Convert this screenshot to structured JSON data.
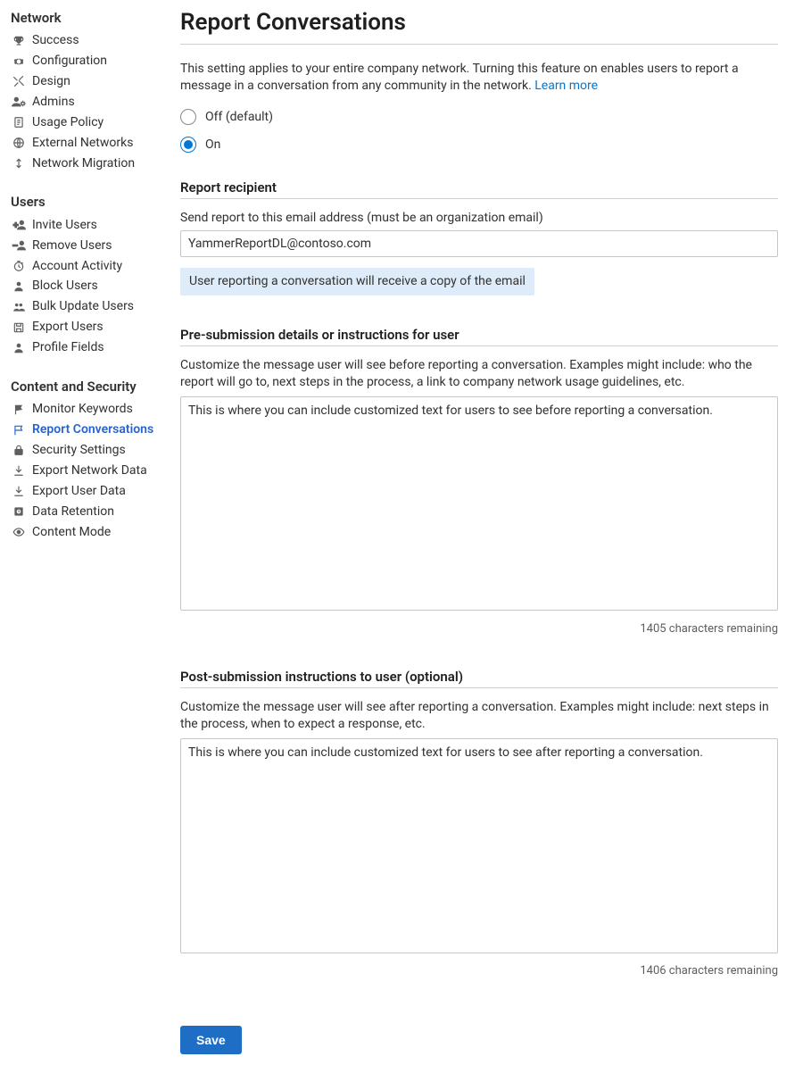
{
  "sidebar": {
    "groups": [
      {
        "title": "Network",
        "items": [
          {
            "label": "Success",
            "selected": false
          },
          {
            "label": "Configuration",
            "selected": false
          },
          {
            "label": "Design",
            "selected": false
          },
          {
            "label": "Admins",
            "selected": false
          },
          {
            "label": "Usage Policy",
            "selected": false
          },
          {
            "label": "External Networks",
            "selected": false
          },
          {
            "label": "Network Migration",
            "selected": false
          }
        ]
      },
      {
        "title": "Users",
        "items": [
          {
            "label": "Invite Users",
            "selected": false
          },
          {
            "label": "Remove Users",
            "selected": false
          },
          {
            "label": "Account Activity",
            "selected": false
          },
          {
            "label": "Block Users",
            "selected": false
          },
          {
            "label": "Bulk Update Users",
            "selected": false
          },
          {
            "label": "Export Users",
            "selected": false
          },
          {
            "label": "Profile Fields",
            "selected": false
          }
        ]
      },
      {
        "title": "Content and Security",
        "items": [
          {
            "label": "Monitor Keywords",
            "selected": false
          },
          {
            "label": "Report Conversations",
            "selected": true
          },
          {
            "label": "Security Settings",
            "selected": false
          },
          {
            "label": "Export Network Data",
            "selected": false
          },
          {
            "label": "Export User Data",
            "selected": false
          },
          {
            "label": "Data Retention",
            "selected": false
          },
          {
            "label": "Content Mode",
            "selected": false
          }
        ]
      }
    ]
  },
  "page": {
    "title": "Report Conversations",
    "description": "This setting applies to your entire company network. Turning this feature on enables users to report a message in a conversation from any community in the network. ",
    "learn_more": "Learn more",
    "radio_off_label": "Off (default)",
    "radio_on_label": "On",
    "radio_selected": "on",
    "recipient": {
      "title": "Report recipient",
      "label": "Send report to this email address (must be an organization email)",
      "value": "YammerReportDL@contoso.com",
      "info": "User reporting a conversation will receive a copy of the email"
    },
    "pre": {
      "title": "Pre-submission details or instructions for user",
      "help": "Customize the message user will see before reporting a conversation. Examples might include: who the report will go to, next steps in the process, a link to company network usage guidelines, etc.",
      "value": "This is where you can include customized text for users to see before reporting a conversation.",
      "remaining": "1405 characters remaining"
    },
    "post": {
      "title": "Post-submission instructions to user (optional)",
      "help": "Customize the message user will see after reporting a conversation. Examples might include: next steps in the process, when to expect a response, etc.",
      "value": "This is where you can include customized text for users to see after reporting a conversation.",
      "remaining": "1406 characters remaining"
    },
    "save_label": "Save"
  },
  "icons": {
    "trophy": "trophy-icon",
    "gear": "gear-icon",
    "tools": "tools-icon",
    "admins": "admins-icon",
    "doc": "document-icon",
    "globe": "globe-icon",
    "migration": "up-down-icon",
    "invite": "invite-user-icon",
    "remove": "remove-user-icon",
    "clock": "clock-icon",
    "block": "person-icon",
    "bulk": "bulk-users-icon",
    "export": "save-icon",
    "profile": "person-solid-icon",
    "flag": "flag-icon",
    "report": "report-flag-icon",
    "lock": "lock-icon",
    "download": "download-icon",
    "retention": "retention-icon",
    "eye": "eye-icon"
  }
}
